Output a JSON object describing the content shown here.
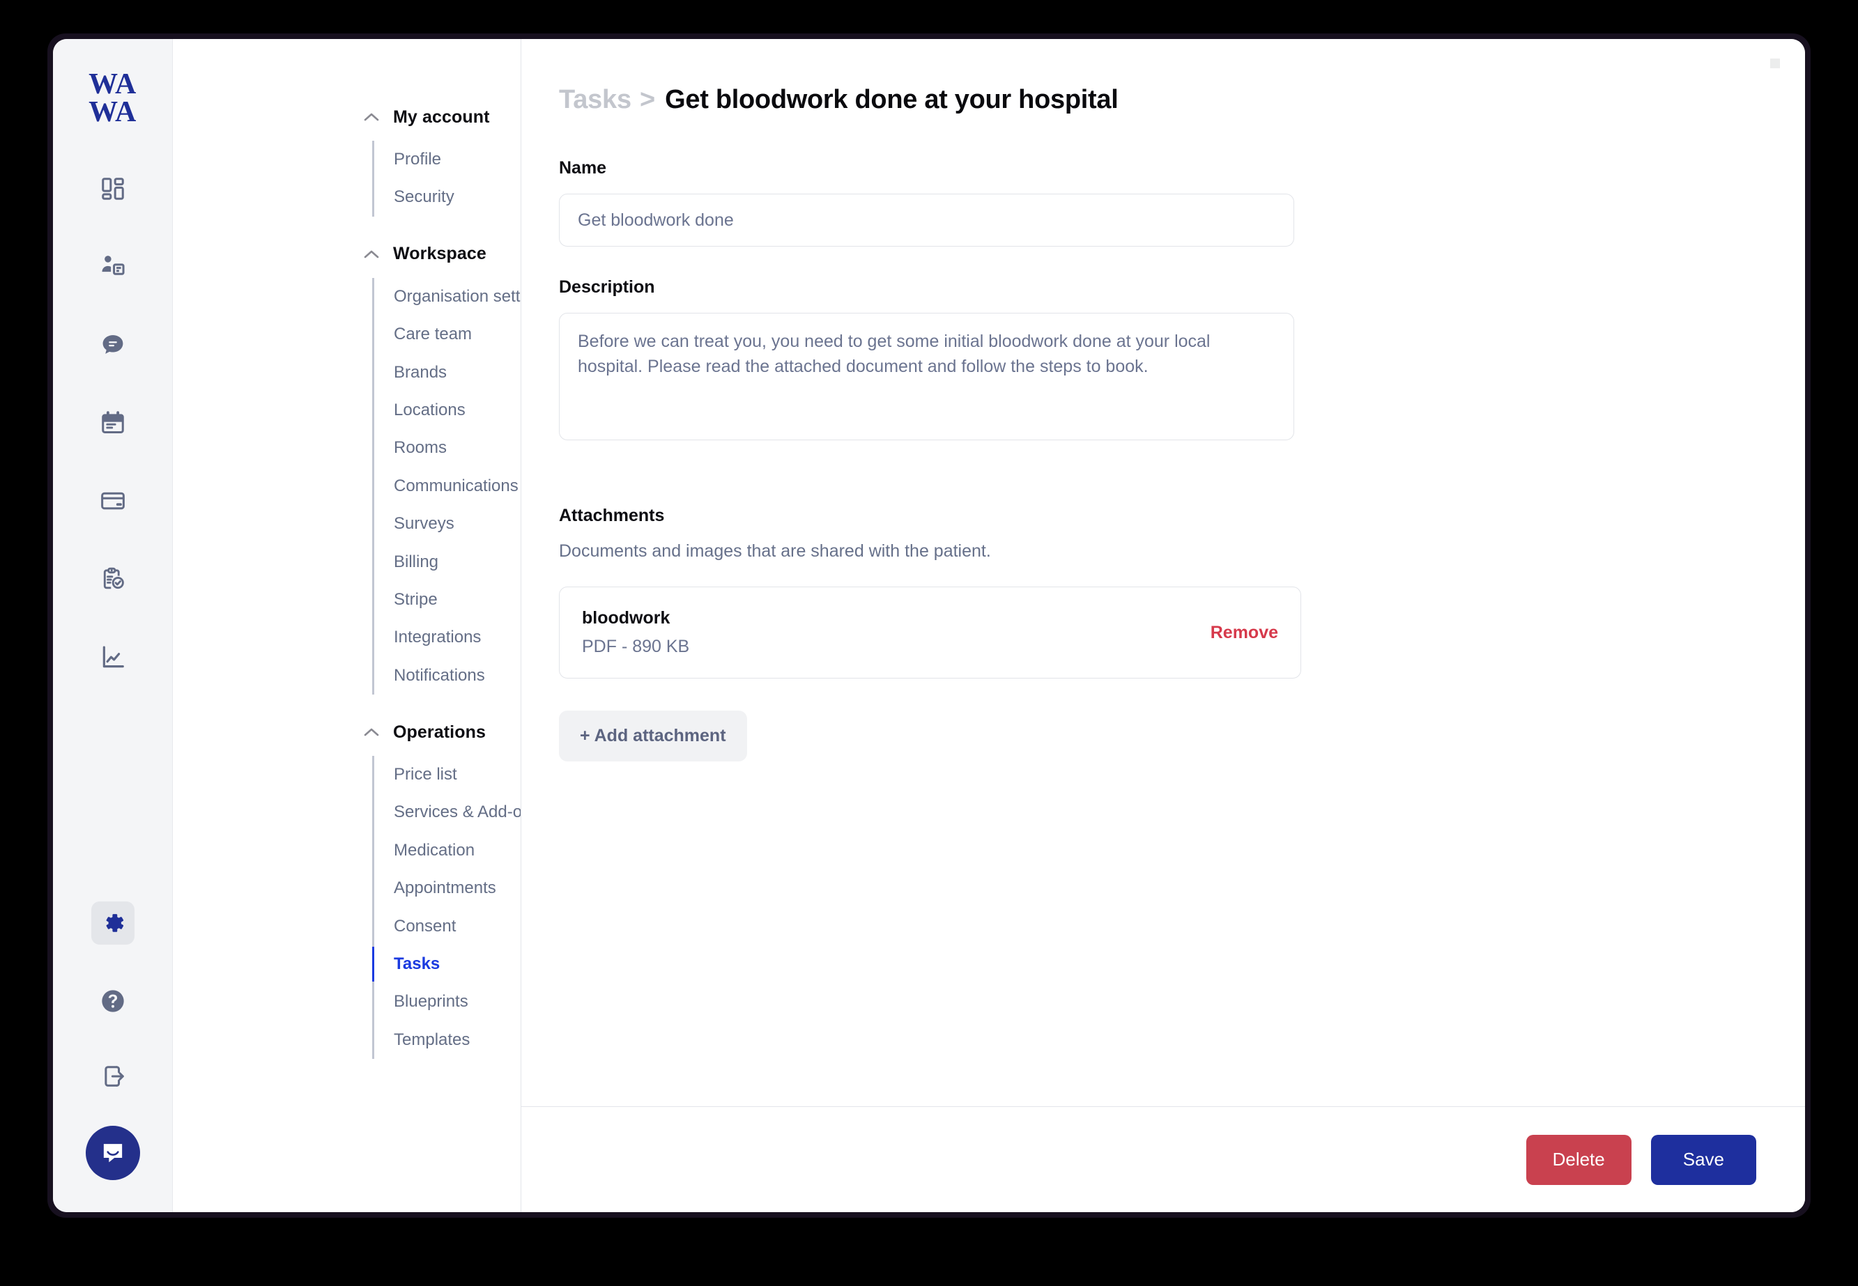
{
  "brand": {
    "logo_line1": "WA",
    "logo_line2": "WA",
    "color": "#1f2f98"
  },
  "rail": {
    "icons": [
      {
        "name": "dashboard-icon",
        "label": "Dashboard"
      },
      {
        "name": "patient-record-icon",
        "label": "Patients"
      },
      {
        "name": "messages-icon",
        "label": "Messages"
      },
      {
        "name": "calendar-icon",
        "label": "Calendar"
      },
      {
        "name": "payments-icon",
        "label": "Payments"
      },
      {
        "name": "tasks-clipboard-check-icon",
        "label": "Tasks"
      },
      {
        "name": "analytics-icon",
        "label": "Analytics"
      }
    ],
    "bottom_icons": [
      {
        "name": "gear-icon",
        "label": "Settings",
        "active": true
      },
      {
        "name": "help-circle-icon",
        "label": "Help"
      },
      {
        "name": "logout-icon",
        "label": "Log out"
      },
      {
        "name": "intercom-chat-icon",
        "label": "Support chat"
      }
    ]
  },
  "nav": {
    "groups": [
      {
        "title": "My account",
        "expanded": true,
        "items": [
          {
            "label": "Profile",
            "active": false
          },
          {
            "label": "Security",
            "active": false
          }
        ]
      },
      {
        "title": "Workspace",
        "expanded": true,
        "items": [
          {
            "label": "Organisation settings",
            "active": false
          },
          {
            "label": "Care team",
            "active": false
          },
          {
            "label": "Brands",
            "active": false
          },
          {
            "label": "Locations",
            "active": false
          },
          {
            "label": "Rooms",
            "active": false
          },
          {
            "label": "Communications",
            "active": false
          },
          {
            "label": "Surveys",
            "active": false
          },
          {
            "label": "Billing",
            "active": false
          },
          {
            "label": "Stripe",
            "active": false
          },
          {
            "label": "Integrations",
            "active": false
          },
          {
            "label": "Notifications",
            "active": false
          }
        ]
      },
      {
        "title": "Operations",
        "expanded": true,
        "items": [
          {
            "label": "Price list",
            "active": false
          },
          {
            "label": "Services & Add-ons",
            "active": false
          },
          {
            "label": "Medication",
            "active": false
          },
          {
            "label": "Appointments",
            "active": false
          },
          {
            "label": "Consent",
            "active": false
          },
          {
            "label": "Tasks",
            "active": true
          },
          {
            "label": "Blueprints",
            "active": false
          },
          {
            "label": "Templates",
            "active": false
          }
        ]
      }
    ]
  },
  "page": {
    "breadcrumb_parent": "Tasks",
    "breadcrumb_separator": ">",
    "title": "Get bloodwork done at your hospital"
  },
  "form": {
    "name": {
      "label": "Name",
      "value": "Get bloodwork done",
      "placeholder": "Get bloodwork done"
    },
    "description": {
      "label": "Description",
      "value": "Before we can treat you, you need to get some initial bloodwork done at your local hospital. Please read the attached document and follow the steps to book."
    },
    "attachments": {
      "label": "Attachments",
      "help_text": "Documents and images that are shared with the patient.",
      "items": [
        {
          "name": "bloodwork",
          "meta": "PDF - 890 KB",
          "remove_label": "Remove"
        }
      ],
      "add_label": "+ Add attachment"
    }
  },
  "footer": {
    "delete_label": "Delete",
    "save_label": "Save",
    "delete_color": "#c9414f",
    "save_color": "#1e2f9e"
  }
}
